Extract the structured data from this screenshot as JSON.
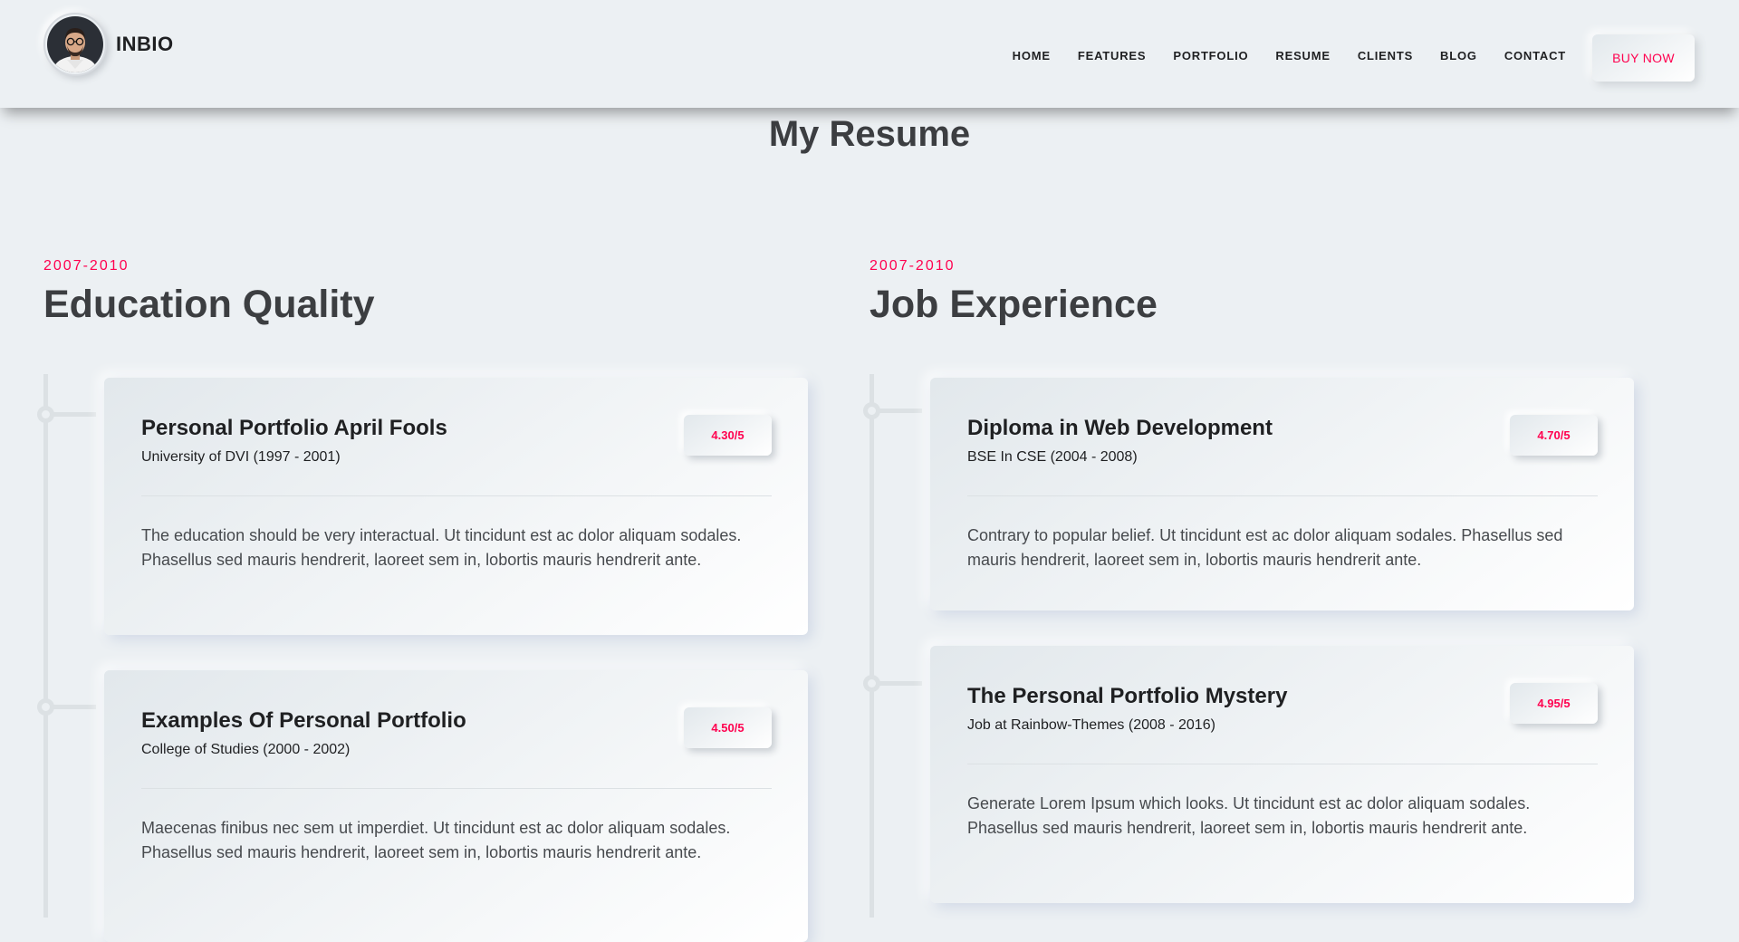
{
  "header": {
    "brand": "INBIO",
    "nav": [
      "HOME",
      "FEATURES",
      "PORTFOLIO",
      "RESUME",
      "CLIENTS",
      "BLOG",
      "CONTACT"
    ],
    "buy_label": "BUY NOW"
  },
  "section": {
    "title": "My Resume"
  },
  "education": {
    "year": "2007-2010",
    "title": "Education Quality",
    "items": [
      {
        "title": "Personal Portfolio April Fools",
        "subtitle": "University of DVI (1997 - 2001)",
        "rating": "4.30/5",
        "description": "The education should be very interactual. Ut tincidunt est ac dolor aliquam sodales. Phasellus sed mauris hendrerit, laoreet sem in, lobortis mauris hendrerit ante."
      },
      {
        "title": "Examples Of Personal Portfolio",
        "subtitle": "College of Studies (2000 - 2002)",
        "rating": "4.50/5",
        "description": "Maecenas finibus nec sem ut imperdiet. Ut tincidunt est ac dolor aliquam sodales. Phasellus sed mauris hendrerit, laoreet sem in, lobortis mauris hendrerit ante."
      }
    ]
  },
  "experience": {
    "year": "2007-2010",
    "title": "Job Experience",
    "items": [
      {
        "title": "Diploma in Web Development",
        "subtitle": "BSE In CSE (2004 - 2008)",
        "rating": "4.70/5",
        "description": "Contrary to popular belief. Ut tincidunt est ac dolor aliquam sodales. Phasellus sed mauris hendrerit, laoreet sem in, lobortis mauris hendrerit ante."
      },
      {
        "title": "The Personal Portfolio Mystery",
        "subtitle": "Job at Rainbow-Themes (2008 - 2016)",
        "rating": "4.95/5",
        "description": "Generate Lorem Ipsum which looks. Ut tincidunt est ac dolor aliquam sodales. Phasellus sed mauris hendrerit, laoreet sem in, lobortis mauris hendrerit ante."
      }
    ]
  },
  "colors": {
    "accent": "#ff014f",
    "background": "#ecf0f3",
    "heading": "#3c3e41"
  }
}
